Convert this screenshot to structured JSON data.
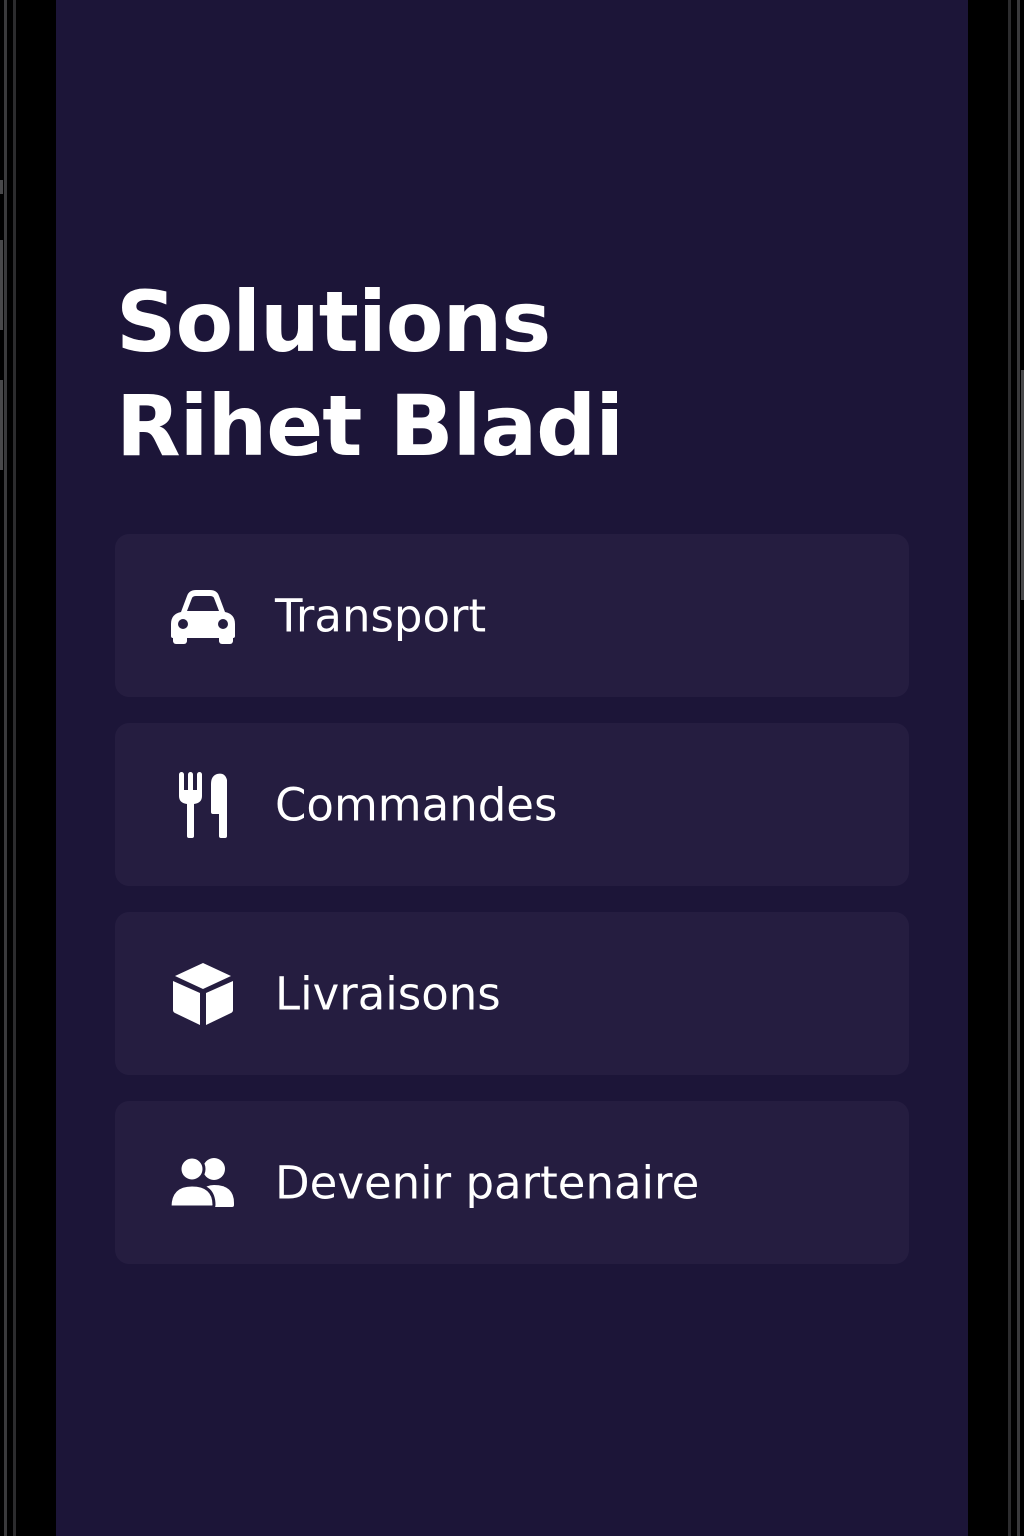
{
  "title": {
    "line1": "Solutions",
    "line2": "Rihet Bladi"
  },
  "menu": {
    "items": [
      {
        "label": "Transport",
        "icon": "car-icon"
      },
      {
        "label": "Commandes",
        "icon": "fork-knife-icon"
      },
      {
        "label": "Livraisons",
        "icon": "package-icon"
      },
      {
        "label": "Devenir partenaire",
        "icon": "users-icon"
      }
    ]
  },
  "colors": {
    "background": "#1c1538",
    "card": "#251d40",
    "text": "#ffffff",
    "frame": "#000000"
  }
}
